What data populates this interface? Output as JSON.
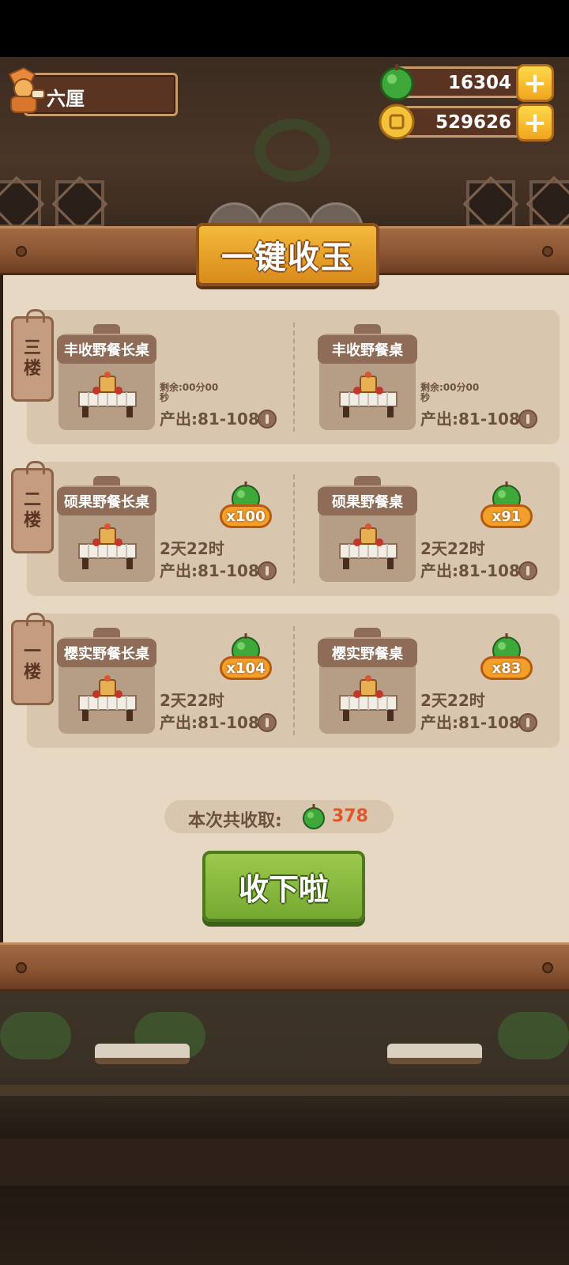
{
  "player": {
    "name": "六厘"
  },
  "currencies": {
    "jade": {
      "value": "16304",
      "icon": "jade-icon"
    },
    "coin": {
      "value": "529626",
      "icon": "gold-coin-icon"
    },
    "plus_label": "+"
  },
  "panel": {
    "title": "一键收玉",
    "floors": [
      {
        "tag_chars": [
          "三",
          "楼"
        ],
        "slots": [
          {
            "name": "丰收野餐长桌",
            "status": "剩余:00分00秒",
            "status_type": "small",
            "output": "产出:81-108",
            "badge": null
          },
          {
            "name": "丰收野餐桌",
            "status": "剩余:00分00秒",
            "status_type": "small",
            "output": "产出:81-108",
            "badge": null
          }
        ]
      },
      {
        "tag_chars": [
          "二",
          "楼"
        ],
        "slots": [
          {
            "name": "硕果野餐长桌",
            "status": "2天22时",
            "status_type": "big",
            "output": "产出:81-108",
            "badge": "x100"
          },
          {
            "name": "硕果野餐桌",
            "status": "2天22时",
            "status_type": "big",
            "output": "产出:81-108",
            "badge": "x91"
          }
        ]
      },
      {
        "tag_chars": [
          "一",
          "楼"
        ],
        "slots": [
          {
            "name": "樱实野餐长桌",
            "status": "2天22时",
            "status_type": "big",
            "output": "产出:81-108",
            "badge": "x104"
          },
          {
            "name": "樱实野餐桌",
            "status": "2天22时",
            "status_type": "big",
            "output": "产出:81-108",
            "badge": "x83"
          }
        ]
      }
    ],
    "summary": {
      "label": "本次共收取:",
      "value": "378"
    },
    "collect_button": "收下啦"
  },
  "colors": {
    "accent_green": "#76a831",
    "title_gold": "#f3ba3c",
    "summary_value": "#e2542a",
    "wood": "#8b5634"
  }
}
